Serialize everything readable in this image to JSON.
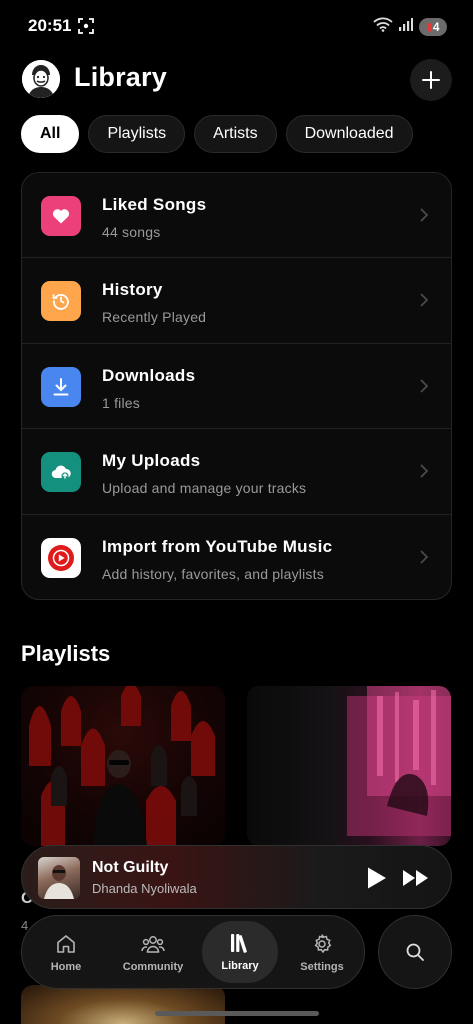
{
  "status_bar": {
    "time": "20:51",
    "battery": "4"
  },
  "header": {
    "title": "Library"
  },
  "filters": [
    {
      "label": "All",
      "active": true
    },
    {
      "label": "Playlists",
      "active": false
    },
    {
      "label": "Artists",
      "active": false
    },
    {
      "label": "Downloaded",
      "active": false
    }
  ],
  "library_items": [
    {
      "title": "Liked Songs",
      "subtitle": "44 songs",
      "icon": "heart-icon",
      "color": "#ec407a"
    },
    {
      "title": "History",
      "subtitle": "Recently Played",
      "icon": "history-icon",
      "color": "#ffa64d"
    },
    {
      "title": "Downloads",
      "subtitle": "1 files",
      "icon": "download-icon",
      "color": "#4a86f0"
    },
    {
      "title": "My Uploads",
      "subtitle": "Upload and manage your tracks",
      "icon": "cloud-upload-icon",
      "color": "#14907e"
    },
    {
      "title": "Import from YouTube Music",
      "subtitle": "Add history, favorites, and playlists",
      "icon": "youtube-music-icon",
      "color": "#ffffff"
    }
  ],
  "playlists_section": {
    "title": "Playlists",
    "peek_title": "O",
    "peek_count": "4"
  },
  "now_playing": {
    "title": "Not Guilty",
    "artist": "Dhanda Nyoliwala"
  },
  "nav": {
    "home": "Home",
    "community": "Community",
    "library": "Library",
    "settings": "Settings"
  }
}
